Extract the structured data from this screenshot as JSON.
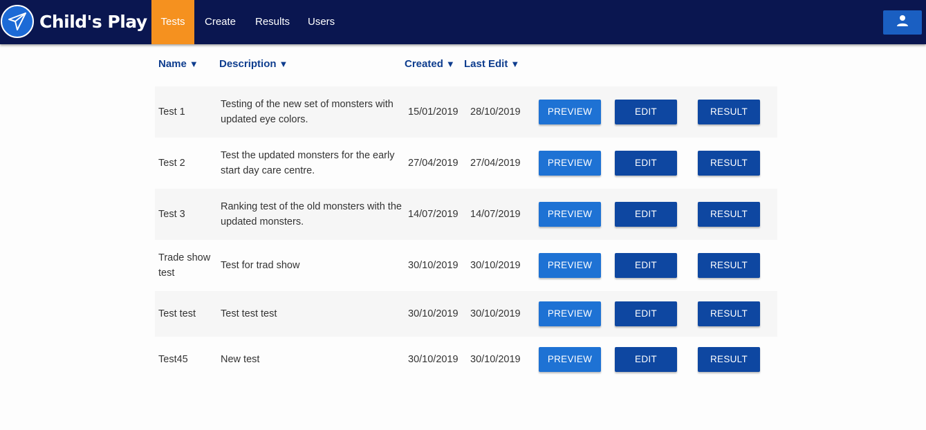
{
  "app": {
    "brand": "Child's Play",
    "logo_icon": "paper-plane-icon",
    "colors": {
      "navbar": "#0a1650",
      "active_tab": "#f5911f",
      "header_text": "#0e3d8e",
      "preview_button": "#1e72d4",
      "action_button": "#0e47a1"
    }
  },
  "nav": {
    "items": [
      {
        "label": "Tests",
        "active": true
      },
      {
        "label": "Create",
        "active": false
      },
      {
        "label": "Results",
        "active": false
      },
      {
        "label": "Users",
        "active": false
      }
    ],
    "user_icon": "user-icon"
  },
  "table": {
    "headers": [
      {
        "label": "Name",
        "sort_icon": "▼"
      },
      {
        "label": "Description",
        "sort_icon": "▼"
      },
      {
        "label": "Created",
        "sort_icon": "▼"
      },
      {
        "label": "Last Edit",
        "sort_icon": "▼"
      }
    ],
    "buttons": {
      "preview": "PREVIEW",
      "edit": "EDIT",
      "result": "RESULT"
    },
    "rows": [
      {
        "name": "Test 1",
        "description": "Testing of the new set of monsters with updated eye colors.",
        "created": "15/01/2019",
        "last_edit": "28/10/2019"
      },
      {
        "name": "Test 2",
        "description": "Test the updated monsters for the early start day care centre.",
        "created": "27/04/2019",
        "last_edit": "27/04/2019"
      },
      {
        "name": "Test 3",
        "description": "Ranking test of the old monsters with the updated monsters.",
        "created": "14/07/2019",
        "last_edit": "14/07/2019"
      },
      {
        "name": "Trade show test",
        "description": "Test for trad show",
        "created": "30/10/2019",
        "last_edit": "30/10/2019"
      },
      {
        "name": "Test test",
        "description": "Test test test",
        "created": "30/10/2019",
        "last_edit": "30/10/2019"
      },
      {
        "name": "Test45",
        "description": "New test",
        "created": "30/10/2019",
        "last_edit": "30/10/2019"
      }
    ]
  }
}
